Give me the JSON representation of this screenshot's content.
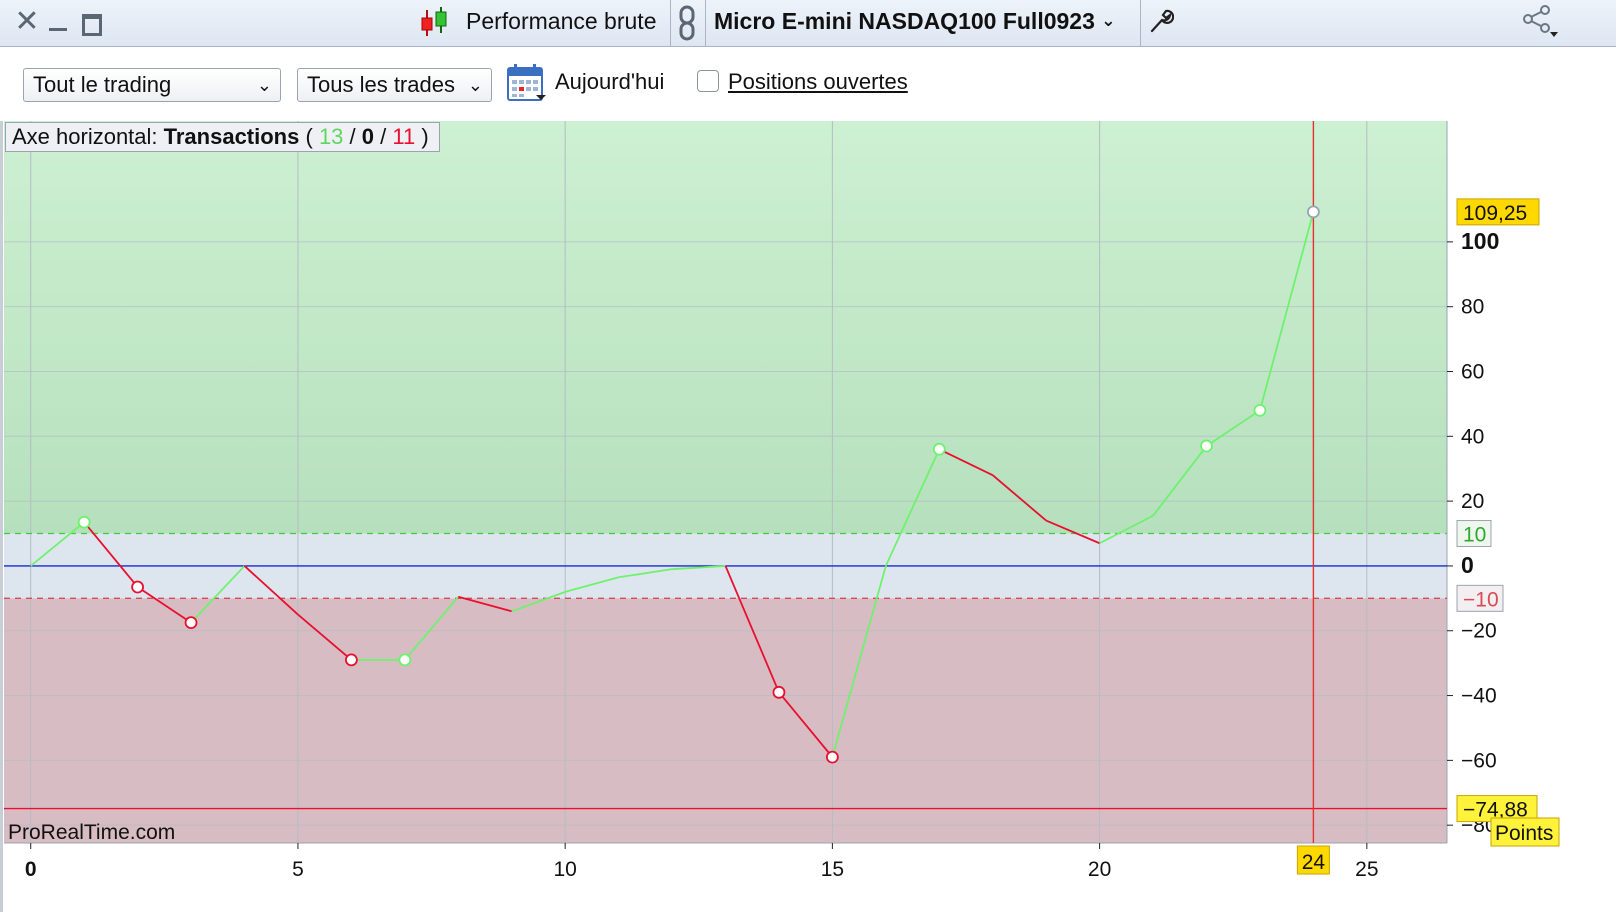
{
  "window": {
    "close_icon": "close-icon",
    "minimize_icon": "minimize-icon",
    "maximize_icon": "maximize-icon",
    "performance_label": "Performance brute",
    "instrument_label": "Micro E-mini NASDAQ100 Full0923",
    "link_icon": "link-icon",
    "wrench_icon": "wrench-icon",
    "share_icon": "share-icon"
  },
  "toolbar": {
    "scope_select": "Tout le trading",
    "trades_select": "Tous les trades",
    "calendar_icon": "calendar-icon",
    "today_label": "Aujourd'hui",
    "open_positions_label": "Positions ouvertes",
    "open_positions_checked": false
  },
  "legend": {
    "prefix": "Axe horizontal: ",
    "mode": "Transactions",
    "open_paren": "( ",
    "wins": "13",
    "slash1": " / ",
    "neutral": "0",
    "slash2": " / ",
    "losses": "11",
    "close_paren": " )"
  },
  "watermark": "ProRealTime.com",
  "colors": {
    "win_line": "#6ef26e",
    "loss_line": "#e8102e",
    "zero_line": "#1a2bd0",
    "cursor": "#e8302e",
    "value_badge": "#ffd800",
    "green_zone": "#c9eecd",
    "red_zone": "#d8bcc4"
  },
  "chart_data": {
    "type": "line",
    "title": "Performance brute",
    "xlabel": "Transactions",
    "ylabel": "Points",
    "x": [
      0,
      1,
      2,
      3,
      4,
      5,
      6,
      7,
      8,
      9,
      10,
      11,
      12,
      13,
      14,
      15,
      16,
      17,
      18,
      19,
      20,
      21,
      22,
      23,
      24
    ],
    "y": [
      0,
      13.5,
      -6.5,
      -17.5,
      0,
      -15,
      -29,
      -29,
      -9.5,
      -14,
      -8,
      -3.5,
      -1,
      0,
      -39,
      -59,
      0,
      36,
      28,
      14,
      7,
      15.5,
      37,
      48,
      109.25
    ],
    "markers_at": [
      1,
      2,
      3,
      6,
      7,
      14,
      15,
      17,
      22,
      23,
      24
    ],
    "xlim": [
      -0.5,
      26.5
    ],
    "ylim": [
      -85.5,
      137.3
    ],
    "x_ticks": [
      "0",
      "5",
      "10",
      "15",
      "20",
      "25"
    ],
    "y_ticks": [
      "100",
      "80",
      "60",
      "40",
      "20",
      "0",
      "-20",
      "-40",
      "-60",
      "-80"
    ],
    "threshold_upper": 10,
    "threshold_lower": -10,
    "threshold_upper_label": "10",
    "threshold_lower_label": "-10",
    "max_drawdown_value": -74.88,
    "max_drawdown_label": "-74,88",
    "current_value_label": "109,25",
    "cursor_x": 24,
    "cursor_x_label": "24",
    "y_unit_label": "Points",
    "grid": true
  }
}
